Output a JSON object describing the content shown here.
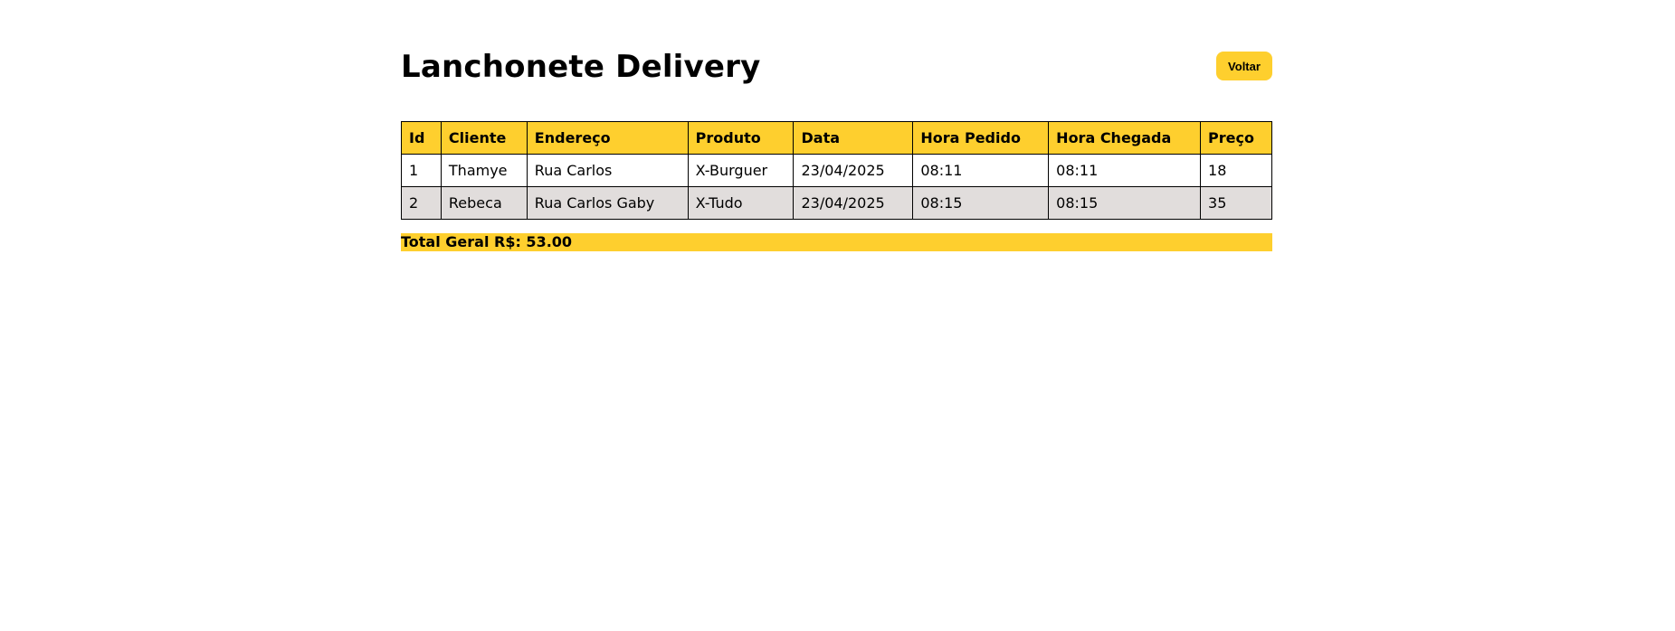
{
  "header": {
    "title": "Lanchonete Delivery",
    "back_label": "Voltar"
  },
  "table": {
    "columns": [
      "Id",
      "Cliente",
      "Endereço",
      "Produto",
      "Data",
      "Hora Pedido",
      "Hora Chegada",
      "Preço"
    ],
    "rows": [
      [
        "1",
        "Thamye",
        "Rua Carlos",
        "X-Burguer",
        "23/04/2025",
        "08:11",
        "08:11",
        "18"
      ],
      [
        "2",
        "Rebeca",
        "Rua Carlos Gaby",
        "X-Tudo",
        "23/04/2025",
        "08:15",
        "08:15",
        "35"
      ]
    ]
  },
  "total": {
    "label": "Total Geral R$: 53.00"
  },
  "colors": {
    "accent": "#fecf2e",
    "row_alt": "#e1dddc"
  }
}
